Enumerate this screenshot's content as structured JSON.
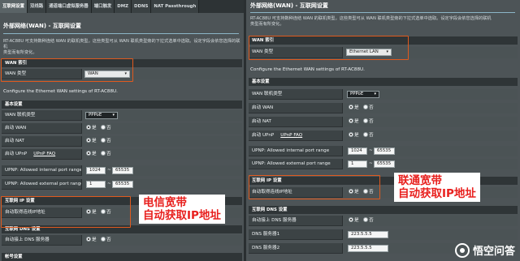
{
  "left": {
    "tabs": [
      "互联网设置",
      "双线路",
      "通道端口虚拟服务器",
      "端口触发",
      "DMZ",
      "DDNS",
      "NAT Passthrough"
    ],
    "title": "外部网络(WAN) - 互联网设置",
    "desc1": "RT-AC88U 可支持数种连结 WAN 的联机类型。这些类型可从 WAN 联机类型旁的下拉式选单中选取。设定字段会依您选择的联机",
    "desc2": "类型而有所变化。",
    "wan_index_header": "WAN 索引",
    "wan_type_label": "WAN 类型",
    "wan_type_value": "WAN",
    "configure_text": "Configure the Ethernet WAN settings of RT-AC88U.",
    "basic_header": "基本设置",
    "conn_type_label": "WAN 联机类型",
    "conn_type_value": "PPPoE",
    "enable_wan_label": "启动 WAN",
    "enable_nat_label": "启动 NAT",
    "enable_upnp_label": "启动 UPnP",
    "upnp_faq": "UPnP  FAQ",
    "internal_range_label": "UPNP: Allowed internal port range",
    "internal_from": "1024",
    "internal_to": "65535",
    "external_range_label": "UPNP: Allowed external port range",
    "external_from": "1",
    "external_to": "65535",
    "ip_header": "互联网 IP 设置",
    "auto_ip_label": "自动取得连线IP地址",
    "dns_header": "互联网 DNS 设置",
    "auto_dns_label": "自动接上 DNS 服务器",
    "account_header": "帐号设置",
    "yes": "是",
    "no": "否",
    "annotation_line1": "电信宽带",
    "annotation_line2": "自动获取IP地址"
  },
  "right": {
    "title": "外部网络(WAN) - 互联网设置",
    "desc1": "RT-AC88U 可支持数种连结 WAN 的联机类型。这些类型可从 WAN 联机类型旁的下拉式选单中选取。设定字段会依您选择的联机",
    "desc2": "类型而有所变化。",
    "wan_index_header": "WAN 索引",
    "wan_type_label": "WAN 类型",
    "wan_type_value": "Ethernet LAN",
    "configure_text": "Configure the Ethernet WAN settings of RT-AC88U.",
    "basic_header": "基本设置",
    "conn_type_label": "WAN 联机类型",
    "conn_type_value": "PPPoE",
    "enable_wan_label": "启动 WAN",
    "enable_nat_label": "启动 NAT",
    "enable_upnp_label": "启动 UPnP",
    "upnp_faq": "UPnP  FAQ",
    "internal_range_label": "UPNP: Allowed internal port range",
    "internal_from": "1024",
    "internal_to": "65535",
    "external_range_label": "UPNP: Allowed external port range",
    "external_from": "1",
    "external_to": "65535",
    "ip_header": "互联网 IP 设置",
    "auto_ip_label": "自动取得连线IP地址",
    "dns_header": "互联网 DNS 设置",
    "auto_dns_label": "自动接上 DNS 服务器",
    "dns1_label": "DNS 服务器1",
    "dns1_value": "223.5.5.5",
    "dns2_label": "DNS 服务器2",
    "dns2_value": "223.5.5.5",
    "yes": "是",
    "no": "否",
    "annotation_line1": "联通宽带",
    "annotation_line2": "自动获取IP地址"
  },
  "watermark": "悟空问答",
  "colors": {
    "highlight": "#e05a1e",
    "annotation_text": "#e8201e",
    "panel_bg": "#4d5457"
  }
}
